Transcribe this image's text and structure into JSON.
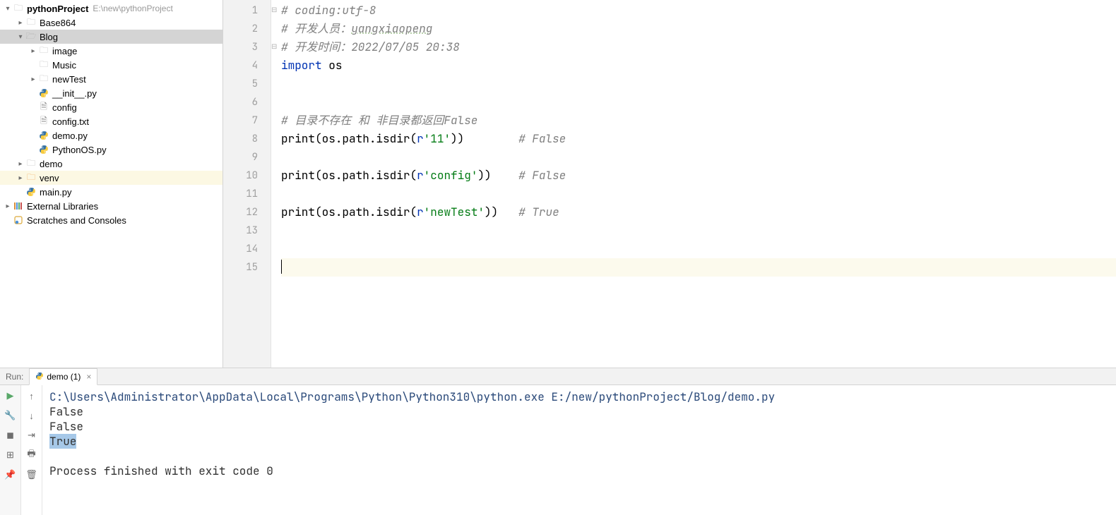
{
  "project": {
    "name": "pythonProject",
    "path": "E:\\new\\pythonProject",
    "tree": [
      {
        "label": "Base864",
        "icon": "folder",
        "depth": 1,
        "chev": ">"
      },
      {
        "label": "Blog",
        "icon": "folder-open",
        "depth": 1,
        "chev": "v",
        "selected": true
      },
      {
        "label": "image",
        "icon": "folder",
        "depth": 2,
        "chev": ">"
      },
      {
        "label": "Music",
        "icon": "folder",
        "depth": 2,
        "chev": ""
      },
      {
        "label": "newTest",
        "icon": "folder",
        "depth": 2,
        "chev": ">"
      },
      {
        "label": "__init__.py",
        "icon": "pyfile",
        "depth": 2,
        "chev": ""
      },
      {
        "label": "config",
        "icon": "txtfile",
        "depth": 2,
        "chev": ""
      },
      {
        "label": "config.txt",
        "icon": "txtfile",
        "depth": 2,
        "chev": ""
      },
      {
        "label": "demo.py",
        "icon": "pyfile",
        "depth": 2,
        "chev": ""
      },
      {
        "label": "PythonOS.py",
        "icon": "pyfile",
        "depth": 2,
        "chev": ""
      },
      {
        "label": "demo",
        "icon": "folder",
        "depth": 1,
        "chev": ">"
      },
      {
        "label": "venv",
        "icon": "folder-orange",
        "depth": 1,
        "chev": ">",
        "venv": true
      },
      {
        "label": "main.py",
        "icon": "pyfile",
        "depth": 1,
        "chev": ""
      }
    ],
    "external_libs": "External Libraries",
    "scratches": "Scratches and Consoles"
  },
  "editor": {
    "lines": [
      {
        "n": 1,
        "html": "<span class='cm-com'># coding:utf-8</span>"
      },
      {
        "n": 2,
        "html": "<span class='cm-com'># 开发人员：</span><span class='cm-com-und'>yangxiaopeng</span>"
      },
      {
        "n": 3,
        "html": "<span class='cm-com'># 开发时间：2022/07/05 20:38</span>"
      },
      {
        "n": 4,
        "html": "<span class='cm-kw'>import</span> <span class='cm-id'>os</span>"
      },
      {
        "n": 5,
        "html": ""
      },
      {
        "n": 6,
        "html": ""
      },
      {
        "n": 7,
        "html": "<span class='cm-com'># 目录不存在 和 非目录都返回False</span>"
      },
      {
        "n": 8,
        "html": "<span class='cm-fn'>print</span>(os.path.isdir(<span class='cm-strp'>r</span><span class='cm-str'>'11'</span>))        <span class='cm-com'># False</span>"
      },
      {
        "n": 9,
        "html": ""
      },
      {
        "n": 10,
        "html": "<span class='cm-fn'>print</span>(os.path.isdir(<span class='cm-strp'>r</span><span class='cm-str'>'config'</span>))    <span class='cm-com'># False</span>"
      },
      {
        "n": 11,
        "html": ""
      },
      {
        "n": 12,
        "html": "<span class='cm-fn'>print</span>(os.path.isdir(<span class='cm-strp'>r</span><span class='cm-str'>'newTest'</span>))   <span class='cm-com'># True</span>"
      },
      {
        "n": 13,
        "html": ""
      },
      {
        "n": 14,
        "html": ""
      },
      {
        "n": 15,
        "html": "",
        "current": true
      }
    ],
    "fold_markers": {
      "1": "⊟",
      "3": "⊟"
    }
  },
  "run": {
    "title": "Run:",
    "tab": "demo (1)",
    "cmd": "C:\\Users\\Administrator\\AppData\\Local\\Programs\\Python\\Python310\\python.exe E:/new/pythonProject/Blog/demo.py",
    "output": [
      "False",
      "False",
      "True"
    ],
    "highlighted_output_index": 2,
    "exit": "Process finished with exit code 0",
    "left_tools": [
      "play",
      "wrench",
      "stop",
      "layout",
      "pin"
    ],
    "right_tools": [
      "up",
      "down",
      "wrap",
      "print",
      "trash"
    ]
  }
}
